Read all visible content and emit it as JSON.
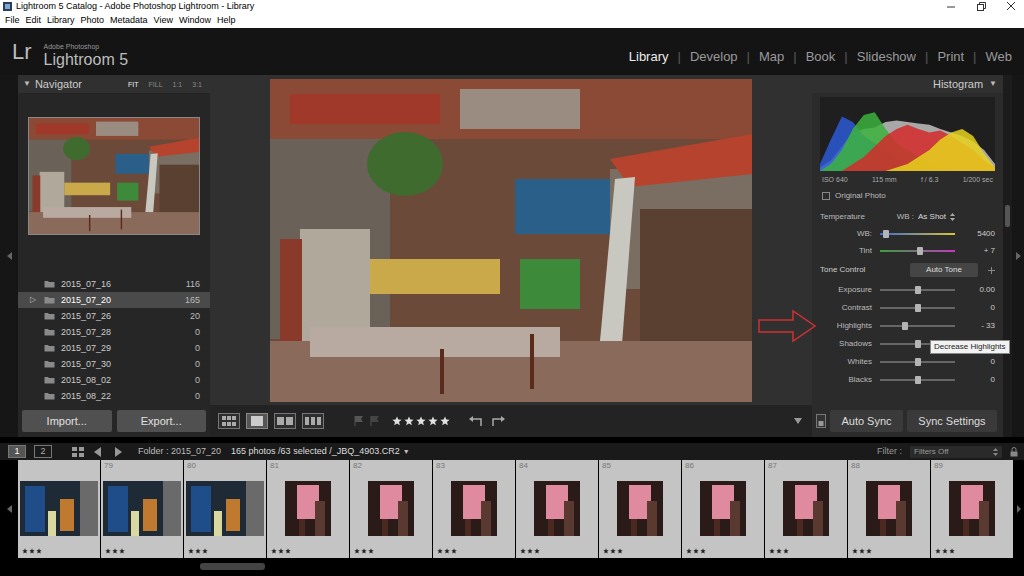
{
  "window": {
    "title": "Lightroom 5 Catalog - Adobe Photoshop Lightroom - Library"
  },
  "menu": [
    "File",
    "Edit",
    "Library",
    "Photo",
    "Metadata",
    "View",
    "Window",
    "Help"
  ],
  "identity": {
    "logo": "Lr",
    "brand": "Adobe Photoshop",
    "product": "Lightroom 5"
  },
  "modules": [
    {
      "label": "Library",
      "selected": true
    },
    {
      "label": "Develop",
      "selected": false
    },
    {
      "label": "Map",
      "selected": false
    },
    {
      "label": "Book",
      "selected": false
    },
    {
      "label": "Slideshow",
      "selected": false
    },
    {
      "label": "Print",
      "selected": false
    },
    {
      "label": "Web",
      "selected": false
    }
  ],
  "module_separator": "|",
  "navigator": {
    "toggle": "▼",
    "title": "Navigator",
    "zoom": [
      {
        "label": "FIT",
        "selected": true
      },
      {
        "label": "FILL",
        "selected": false
      },
      {
        "label": "1:1",
        "selected": false
      },
      {
        "label": "3:1",
        "selected": false
      }
    ]
  },
  "folders": [
    {
      "name": "2015_07_16",
      "count": "116",
      "selected": false
    },
    {
      "expander": "▷",
      "name": "2015_07_20",
      "count": "165",
      "selected": true
    },
    {
      "name": "2015_07_26",
      "count": "20",
      "selected": false
    },
    {
      "name": "2015_07_28",
      "count": "0",
      "selected": false
    },
    {
      "name": "2015_07_29",
      "count": "0",
      "selected": false
    },
    {
      "name": "2015_07_30",
      "count": "0",
      "selected": false
    },
    {
      "name": "2015_08_02",
      "count": "0",
      "selected": false
    },
    {
      "name": "2015_08_22",
      "count": "0",
      "selected": false
    }
  ],
  "left_buttons": [
    "Import...",
    "Export..."
  ],
  "toolbar": {
    "stars": 5
  },
  "histogram": {
    "title": "Histogram",
    "toggle": "▼",
    "series": [
      {
        "color": "#a8a8a8",
        "values": [
          0.05,
          0.15,
          0.35,
          0.55,
          0.6,
          0.62,
          0.7,
          0.72,
          0.7,
          0.68,
          0.66,
          0.6,
          0.55,
          0.5,
          0.42,
          0.3,
          0.1
        ]
      },
      {
        "color": "#2d5bd6",
        "values": [
          0.1,
          0.45,
          0.78,
          0.7,
          0.5,
          0.4,
          0.3,
          0.2,
          0.1,
          0.05,
          0,
          0,
          0,
          0,
          0,
          0,
          0
        ]
      },
      {
        "color": "#3cb33c",
        "values": [
          0,
          0.1,
          0.3,
          0.6,
          0.8,
          0.84,
          0.6,
          0.4,
          0.3,
          0.2,
          0.1,
          0.05,
          0,
          0,
          0,
          0,
          0
        ]
      },
      {
        "color": "#d42a2a",
        "values": [
          0,
          0,
          0,
          0.1,
          0.2,
          0.35,
          0.5,
          0.6,
          0.66,
          0.6,
          0.55,
          0.58,
          0.5,
          0.4,
          0.3,
          0.15,
          0.05
        ]
      },
      {
        "color": "#e6d21c",
        "values": [
          0,
          0,
          0,
          0,
          0,
          0,
          0,
          0.05,
          0.1,
          0.2,
          0.3,
          0.45,
          0.55,
          0.6,
          0.5,
          0.25,
          0.05
        ]
      }
    ],
    "info": [
      "ISO 640",
      "115 mm",
      "f / 6.3",
      "1/200 sec"
    ]
  },
  "original_photo": {
    "label": "Original Photo",
    "checked": false
  },
  "white_balance": {
    "label": "Temperature",
    "wb_label": "WB :",
    "preset": "As Shot"
  },
  "basic_sliders": [
    {
      "label": "WB:",
      "reading": "5400",
      "level": 0.08,
      "kind": "temperature"
    },
    {
      "label": "Tint",
      "reading": "+ 7",
      "level": 0.53,
      "kind": "tint"
    }
  ],
  "tone_control": {
    "title": "Tone Control",
    "button": "Auto Tone",
    "sliders": [
      {
        "label": "Exposure",
        "reading": "0.00",
        "level": 0.5,
        "kind": "plain"
      },
      {
        "label": "Contrast",
        "reading": "0",
        "level": 0.5,
        "kind": "plain"
      },
      {
        "label": "Highlights",
        "reading": "- 33",
        "level": 0.335,
        "kind": "plain"
      },
      {
        "label": "Shadows",
        "reading": "0",
        "level": 0.5,
        "kind": "plain"
      },
      {
        "label": "Whites",
        "reading": "0",
        "level": 0.5,
        "kind": "plain"
      },
      {
        "label": "Blacks",
        "reading": "0",
        "level": 0.5,
        "kind": "plain"
      }
    ]
  },
  "tooltip": "Decrease Highlights",
  "sync": {
    "auto_sync": "Auto Sync",
    "sync_settings": "Sync Settings"
  },
  "filmstrip_bar": {
    "pages": [
      {
        "label": "1",
        "selected": true
      },
      {
        "label": "2",
        "selected": false
      }
    ],
    "folder": "Folder : 2015_07_20",
    "info": "165 photos /63 selected /_JBQ_4903.CR2",
    "dropdown": "▼",
    "filter_label": "Filter :",
    "filter": "Filters Off"
  },
  "filmstrip": [
    {
      "stars": 3,
      "selected": true,
      "kind": "street"
    },
    {
      "number": "79",
      "stars": 3,
      "selected": true,
      "kind": "street"
    },
    {
      "number": "80",
      "stars": 3,
      "selected": true,
      "kind": "street"
    },
    {
      "number": "81",
      "stars": 3,
      "selected": true,
      "kind": "pink"
    },
    {
      "number": "82",
      "stars": 3,
      "selected": true,
      "kind": "pink"
    },
    {
      "number": "83",
      "stars": 3,
      "selected": true,
      "kind": "pink"
    },
    {
      "number": "84",
      "stars": 3,
      "selected": true,
      "kind": "pink"
    },
    {
      "number": "85",
      "stars": 3,
      "selected": true,
      "kind": "pink"
    },
    {
      "number": "86",
      "stars": 3,
      "selected": true,
      "kind": "pink"
    },
    {
      "number": "87",
      "stars": 3,
      "selected": true,
      "kind": "pink"
    },
    {
      "number": "88",
      "stars": 3,
      "selected": true,
      "kind": "pink"
    },
    {
      "number": "89",
      "stars": 3,
      "selected": true,
      "kind": "pink"
    }
  ]
}
